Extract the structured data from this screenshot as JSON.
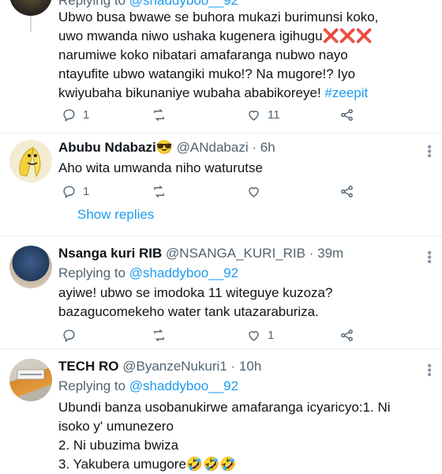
{
  "tweet1": {
    "replying_prefix": "Replying to",
    "replying_handle": "@shaddyboo__92",
    "text_lines": [
      "Ubwo busa bwawe se buhora mukazi burimunsi koko,",
      "uwo mwanda niwo ushaka kugenera igihugu",
      "narumiwe koko nibatari amafaranga nubwo nayo",
      "ntayufite ubwo watangiki muko!? Na mugore!? Iyo",
      "kwiyubaha bikunaniye wubaha ababikoreye!"
    ],
    "x_marks": "❌❌❌",
    "hashtag": "#zeepit",
    "replies": "1",
    "retweets": "",
    "likes": "11"
  },
  "tweet2": {
    "name": "Abubu Ndabazi",
    "badge_emoji": "😎",
    "handle": "@ANdabazi",
    "time": "6h",
    "text": "Aho wita umwanda niho waturutse",
    "replies": "1",
    "retweets": "",
    "likes": "",
    "show_replies": "Show replies"
  },
  "tweet3": {
    "name": "Nsanga kuri RIB",
    "handle": "@NSANGA_KURI_RIB",
    "time": "39m",
    "replying_prefix": "Replying to",
    "replying_handle": "@shaddyboo__92",
    "text_lines": [
      "ayiwe! ubwo se imodoka 11 witeguye kuzoza?",
      "bazagucomekeho water tank utazaraburiza."
    ],
    "replies": "",
    "retweets": "",
    "likes": "1"
  },
  "tweet4": {
    "name": "TECH RO",
    "handle": "@ByanzeNukuri1",
    "time": "10h",
    "replying_prefix": "Replying to",
    "replying_handle": "@shaddyboo__92",
    "text_lines": [
      "Ubundi banza usobanukirwe amafaranga icyaricyo:1. Ni",
      "isoko y' umunezero",
      "2. Ni ubuzima bwiza",
      "3.  Yakubera umugore🤣🤣🤣"
    ]
  },
  "separator": "·",
  "icons": {
    "reply": "reply-icon",
    "retweet": "retweet-icon",
    "like": "heart-icon",
    "share": "share-icon",
    "more": "more-vertical-icon"
  },
  "colors": {
    "accent": "#1d9bf0",
    "muted": "#536471",
    "divider": "#e6ecf0"
  }
}
